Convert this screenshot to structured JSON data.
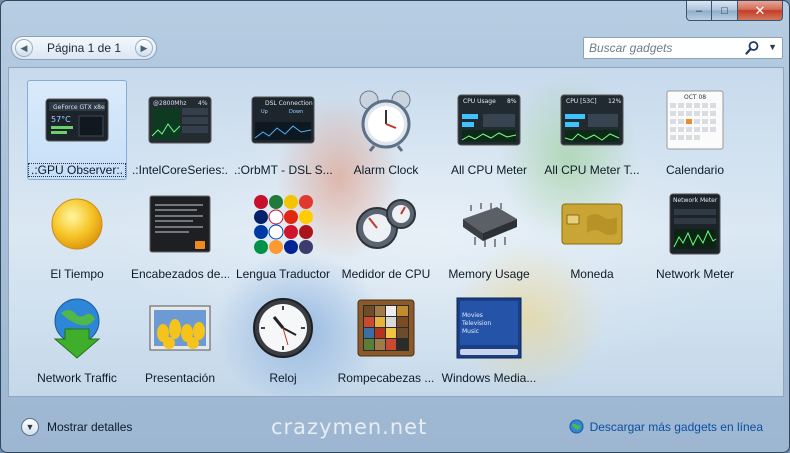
{
  "window": {
    "minimize": "–",
    "maximize": "□",
    "close": "✕"
  },
  "toolbar": {
    "page_label": "Página 1 de 1",
    "prev_icon": "chevron-left-icon",
    "next_icon": "chevron-right-icon",
    "search_placeholder": "Buscar gadgets",
    "search_icon": "search-icon",
    "search_dropdown_icon": "chevron-down-icon"
  },
  "gadgets": [
    {
      "name": ".:GPU Observer:.",
      "icon": "gpu-observer-icon",
      "selected": true
    },
    {
      "name": ".:IntelCoreSeries:.",
      "icon": "intel-core-series-icon"
    },
    {
      "name": ".:OrbMT - DSL S...",
      "icon": "dsl-connection-icon"
    },
    {
      "name": "Alarm Clock",
      "icon": "alarm-clock-icon"
    },
    {
      "name": "All CPU Meter",
      "icon": "cpu-meter-icon"
    },
    {
      "name": "All CPU Meter T...",
      "icon": "cpu-meter-temp-icon"
    },
    {
      "name": "Calendario",
      "icon": "calendar-icon"
    },
    {
      "name": "El Tiempo",
      "icon": "weather-sun-icon"
    },
    {
      "name": "Encabezados de...",
      "icon": "rss-headlines-icon"
    },
    {
      "name": "Lengua Traductor",
      "icon": "flags-translator-icon"
    },
    {
      "name": "Medidor de CPU",
      "icon": "cpu-gauge-icon"
    },
    {
      "name": "Memory Usage",
      "icon": "memory-chip-icon"
    },
    {
      "name": "Moneda",
      "icon": "currency-card-icon"
    },
    {
      "name": "Network Meter",
      "icon": "network-meter-icon"
    },
    {
      "name": "Network Traffic",
      "icon": "globe-download-icon"
    },
    {
      "name": "Presentación",
      "icon": "slideshow-tulips-icon"
    },
    {
      "name": "Reloj",
      "icon": "clock-icon"
    },
    {
      "name": "Rompecabezas ...",
      "icon": "puzzle-icon"
    },
    {
      "name": "Windows Media...",
      "icon": "windows-media-center-icon"
    }
  ],
  "thumb_text": {
    "gpu": "GeForce GTX x8e",
    "gpu_temp": "57°C",
    "intel": "@2800Mhz",
    "intel_pct": "4%",
    "dsl": "DSL Connection",
    "dsl_up": "Up",
    "dsl_down": "Down",
    "cpu_usage": "CPU Usage",
    "cpu_usage_pct": "8%",
    "cpu_temp": "CPU [53C]",
    "cpu_temp_pct": "12%",
    "cal_month": "OCT 08",
    "net_meter": "Network Meter",
    "media_1": "Movies",
    "media_2": "Television",
    "media_3": "Music"
  },
  "status": {
    "details_label": "Mostrar detalles",
    "details_icon": "chevron-down-circle-icon",
    "watermark": "crazymen.net",
    "more_link": "Descargar más gadgets en línea",
    "more_icon": "globe-icon"
  }
}
